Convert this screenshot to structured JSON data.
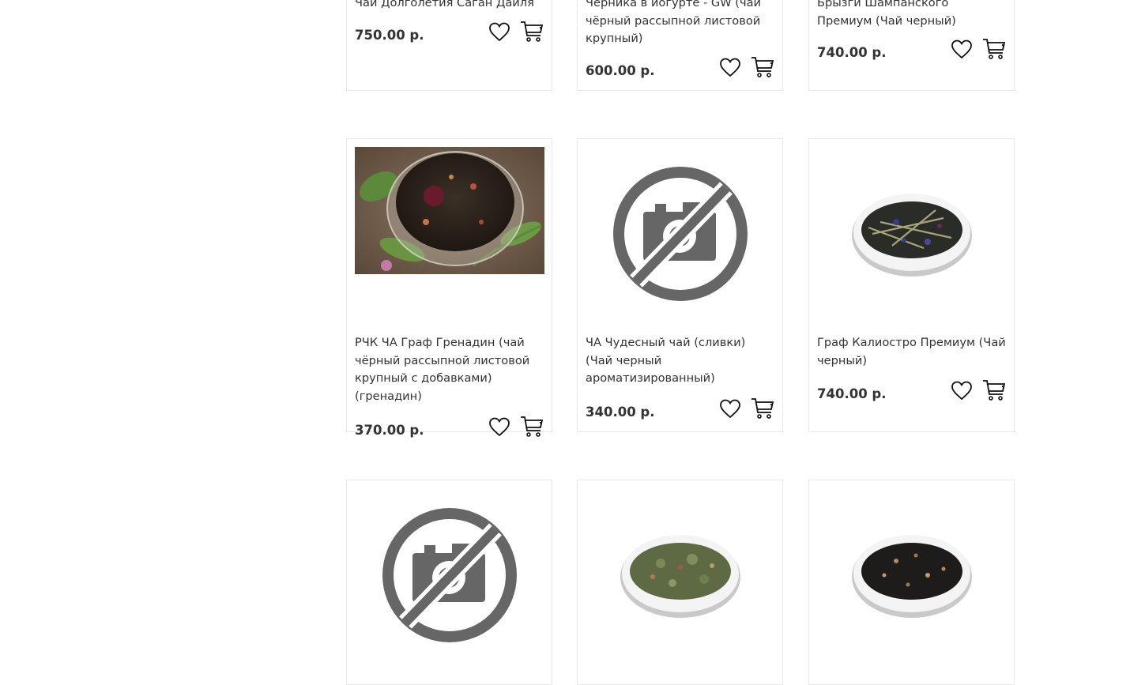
{
  "products": [
    {
      "title": "Чай Долголетия Саган Дайля",
      "price": "750.00 р.",
      "image": "none"
    },
    {
      "title": "Черника в йогурте - GW (чай чёрный рассыпной листовой крупный)",
      "price": "600.00 р.",
      "image": "none"
    },
    {
      "title": "Брызги Шампанского Премиум (Чай черный)",
      "price": "740.00 р.",
      "image": "none"
    },
    {
      "title": "РЧК ЧА Граф Гренадин (чай чёрный рассыпной листовой крупный с добавками) (гренадин)",
      "price": "370.00 р.",
      "image": "tea-glass-photo"
    },
    {
      "title": "ЧА Чудесный чай (сливки) (Чай черный ароматизированный)",
      "price": "340.00 р.",
      "image": "no-photo-placeholder"
    },
    {
      "title": "Граф Калиостро Премиум (Чай черный)",
      "price": "740.00 р.",
      "image": "tea-bowl-dark"
    },
    {
      "title": "",
      "price": "",
      "image": "no-photo-placeholder"
    },
    {
      "title": "",
      "price": "",
      "image": "tea-bowl-green"
    },
    {
      "title": "",
      "price": "",
      "image": "tea-bowl-black"
    }
  ],
  "icons": {
    "wishlist": "heart-icon",
    "cart": "cart-icon"
  },
  "colors": {
    "text": "#333333",
    "border": "#e8e8e8",
    "placeholder": "#666666"
  }
}
